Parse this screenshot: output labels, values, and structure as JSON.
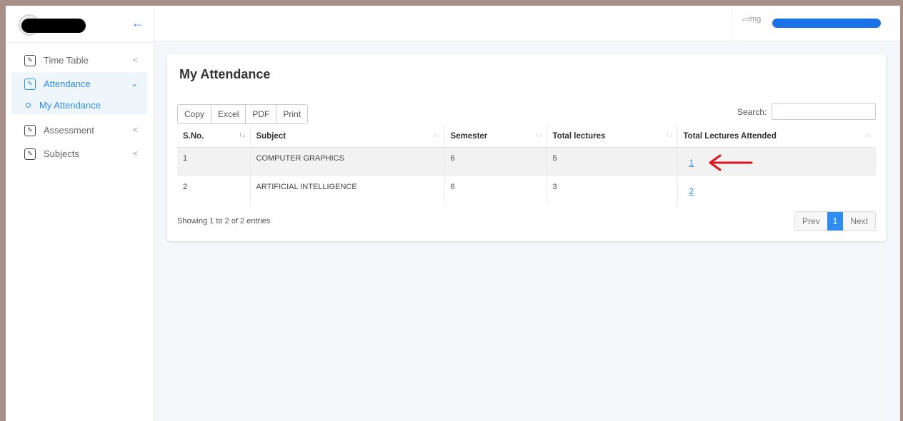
{
  "sidebar": {
    "items": [
      {
        "label": "Time Table"
      },
      {
        "label": "Attendance"
      },
      {
        "label": "My Attendance"
      },
      {
        "label": "Assessment"
      },
      {
        "label": "Subjects"
      }
    ]
  },
  "topbar": {
    "img_alt": "img"
  },
  "page": {
    "title": "My Attendance"
  },
  "toolbar": {
    "copy": "Copy",
    "excel": "Excel",
    "pdf": "PDF",
    "print": "Print"
  },
  "search": {
    "label": "Search:",
    "value": ""
  },
  "table": {
    "headers": [
      "S.No.",
      "Subject",
      "Semester",
      "Total lectures",
      "Total Lectures Attended"
    ],
    "rows": [
      {
        "sno": "1",
        "subject": "COMPUTER GRAPHICS",
        "semester": "6",
        "total": "5",
        "attended": "1"
      },
      {
        "sno": "2",
        "subject": "ARTIFICIAL INTELLIGENCE",
        "semester": "6",
        "total": "3",
        "attended": "2"
      }
    ]
  },
  "footer": {
    "info": "Showing 1 to 2 of 2 entries"
  },
  "pager": {
    "prev": "Prev",
    "current": "1",
    "next": "Next"
  },
  "colors": {
    "accent": "#2f8cf0",
    "annotation_arrow": "#e0131f",
    "redaction_user": "#1a73e8"
  }
}
